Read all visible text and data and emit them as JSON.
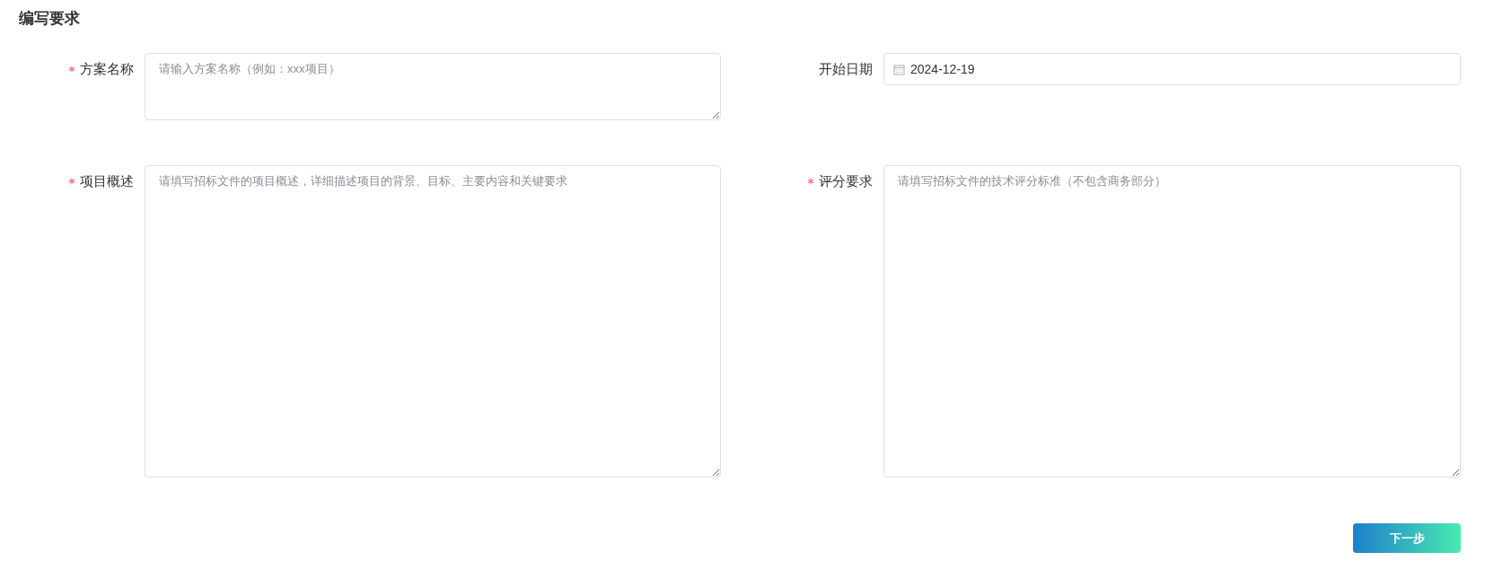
{
  "title": "编写要求",
  "fields": [
    {
      "kind": "textarea",
      "label": "方案名称",
      "required": true,
      "placeholder": "请输入方案名称（例如：xxx项目）"
    },
    {
      "kind": "date",
      "label": "开始日期",
      "required": false,
      "value": "2024-12-19"
    },
    {
      "kind": "textarea",
      "label": "项目概述",
      "required": true,
      "placeholder": "请填写招标文件的项目概述，详细描述项目的背景、目标、主要内容和关键要求"
    },
    {
      "kind": "textarea",
      "label": "评分要求",
      "required": true,
      "placeholder": "请填写招标文件的技术评分标准（不包含商务部分）"
    }
  ],
  "next_button": "下一步"
}
